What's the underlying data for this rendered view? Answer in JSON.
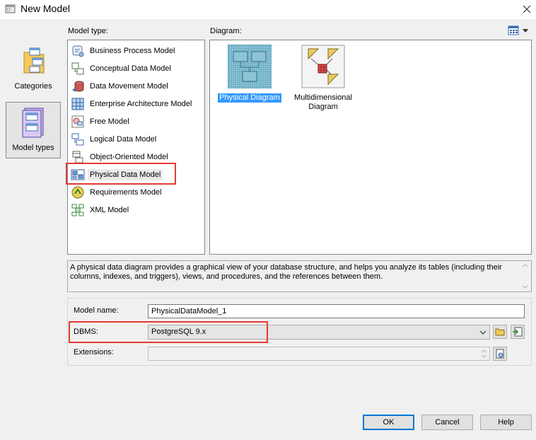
{
  "window": {
    "title": "New Model"
  },
  "left_rail": {
    "items": [
      {
        "label": "Categories",
        "icon": "categories-folder-icon",
        "selected": false
      },
      {
        "label": "Model types",
        "icon": "model-types-icon",
        "selected": true
      }
    ]
  },
  "model_type_panel": {
    "label": "Model type:",
    "items": [
      {
        "label": "Business Process Model",
        "icon": "business-process-icon"
      },
      {
        "label": "Conceptual Data Model",
        "icon": "conceptual-data-icon"
      },
      {
        "label": "Data Movement Model",
        "icon": "data-movement-icon"
      },
      {
        "label": "Enterprise Architecture Model",
        "icon": "enterprise-architecture-icon"
      },
      {
        "label": "Free Model",
        "icon": "free-model-icon"
      },
      {
        "label": "Logical Data Model",
        "icon": "logical-data-icon"
      },
      {
        "label": "Object-Oriented Model",
        "icon": "object-oriented-icon"
      },
      {
        "label": "Physical Data Model",
        "icon": "physical-data-icon",
        "selected": true
      },
      {
        "label": "Requirements Model",
        "icon": "requirements-icon"
      },
      {
        "label": "XML Model",
        "icon": "xml-model-icon"
      }
    ]
  },
  "diagram_panel": {
    "label": "Diagram:",
    "items": [
      {
        "label": "Physical Diagram",
        "icon": "physical-diagram-icon",
        "selected": true
      },
      {
        "label": "Multidimensional Diagram",
        "icon": "multidimensional-diagram-icon",
        "selected": false
      }
    ]
  },
  "description": "A physical data diagram provides a graphical view of your database structure, and helps you analyze its tables (including their columns, indexes, and triggers), views, and procedures, and the references between them.",
  "form": {
    "model_name_label": "Model name:",
    "model_name_value": "PhysicalDataModel_1",
    "dbms_label": "DBMS:",
    "dbms_value": "PostgreSQL 9.x",
    "extensions_label": "Extensions:",
    "extensions_value": ""
  },
  "buttons": {
    "ok": "OK",
    "cancel": "Cancel",
    "help": "Help"
  },
  "colors": {
    "selection": "#3399ff",
    "annotation": "#e53935",
    "default_button_border": "#0078d7"
  }
}
